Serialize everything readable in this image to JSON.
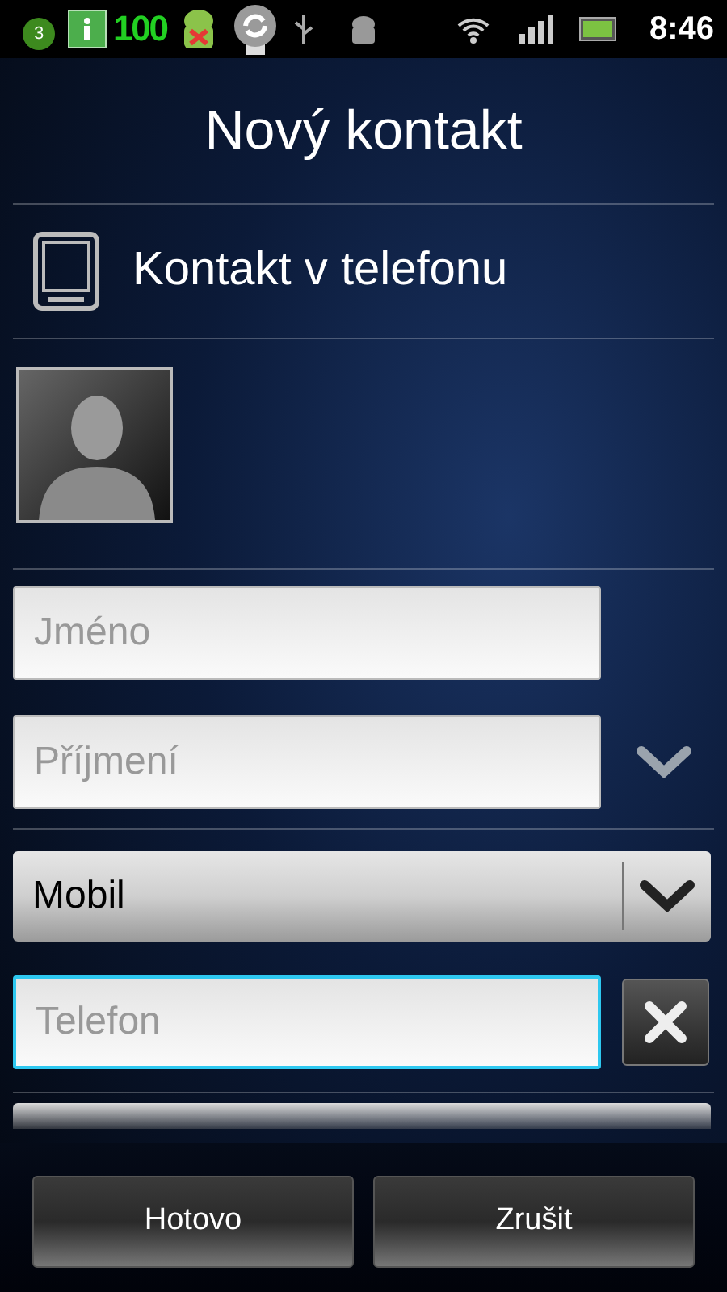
{
  "status_bar": {
    "notification_count": "3",
    "battery_app_level": "100",
    "time": "8:46"
  },
  "title": "Nový kontakt",
  "account": {
    "label": "Kontakt v telefonu"
  },
  "fields": [
    {
      "kind": "text",
      "placeholder": "Jméno",
      "focused": false,
      "expand": false
    },
    {
      "kind": "text",
      "placeholder": "Příjmení",
      "focused": false,
      "expand": true
    }
  ],
  "phone": {
    "type": "Mobil",
    "placeholder": "Telefon",
    "focused": true
  },
  "buttons": [
    {
      "label": "Hotovo"
    },
    {
      "label": "Zrušit"
    }
  ]
}
